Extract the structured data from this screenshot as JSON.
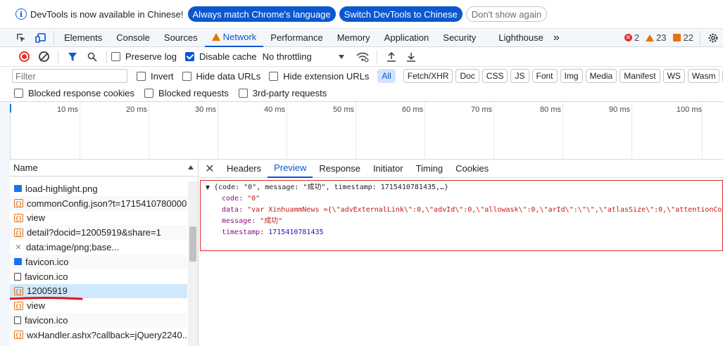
{
  "infobar": {
    "message": "DevTools is now available in Chinese!",
    "btn_match": "Always match Chrome's language",
    "btn_switch": "Switch DevTools to Chinese",
    "btn_dismiss": "Don't show again"
  },
  "tabs": {
    "elements": "Elements",
    "console": "Console",
    "sources": "Sources",
    "network": "Network",
    "performance": "Performance",
    "memory": "Memory",
    "application": "Application",
    "security": "Security",
    "lighthouse": "Lighthouse",
    "more": "»"
  },
  "counters": {
    "errors": "2",
    "warnings": "23",
    "issues": "22"
  },
  "toolbar": {
    "preserve_log": "Preserve log",
    "disable_cache": "Disable cache",
    "throttling": "No throttling"
  },
  "filter": {
    "placeholder": "Filter",
    "invert": "Invert",
    "hide_data_urls": "Hide data URLs",
    "hide_ext_urls": "Hide extension URLs",
    "types": [
      "All",
      "Fetch/XHR",
      "Doc",
      "CSS",
      "JS",
      "Font",
      "Img",
      "Media",
      "Manifest",
      "WS",
      "Wasm",
      "O"
    ]
  },
  "blocked": {
    "cookies": "Blocked response cookies",
    "requests": "Blocked requests",
    "third_party": "3rd-party requests"
  },
  "timeline": {
    "ticks": [
      "10 ms",
      "20 ms",
      "30 ms",
      "40 ms",
      "50 ms",
      "60 ms",
      "70 ms",
      "80 ms",
      "90 ms",
      "100 ms"
    ]
  },
  "requests": {
    "header": "Name",
    "rows": [
      {
        "icon": "png",
        "name": "load-highlight.png"
      },
      {
        "icon": "json",
        "name": "commonConfig.json?t=1715410780000"
      },
      {
        "icon": "json",
        "name": "view"
      },
      {
        "icon": "json",
        "name": "detail?docid=12005919&share=1"
      },
      {
        "icon": "img",
        "name": "data:image/png;base..."
      },
      {
        "icon": "png",
        "name": "favicon.ico"
      },
      {
        "icon": "doc",
        "name": "favicon.ico"
      },
      {
        "icon": "json",
        "name": "12005919"
      },
      {
        "icon": "json",
        "name": "view"
      },
      {
        "icon": "doc",
        "name": "favicon.ico"
      },
      {
        "icon": "json",
        "name": "wxHandler.ashx?callback=jQuery2240..."
      }
    ]
  },
  "detail": {
    "tabs": [
      "Headers",
      "Preview",
      "Response",
      "Initiator",
      "Timing",
      "Cookies"
    ],
    "active_tab": "Preview",
    "summary": "{code: \"0\", message: \"成功\", timestamp: 1715410781435,…}",
    "fields": {
      "code_key": "code:",
      "code_val": "\"0\"",
      "data_key": "data:",
      "data_val": "\"var XinhuammNews ={\\\"advExternalLink\\\":0,\\\"advId\\\":0,\\\"allowask\\\":0,\\\"arId\\\":\\\"\\\",\\\"atlasSize\\\":0,\\\"attentionCou",
      "message_key": "message:",
      "message_val": "\"成功\"",
      "timestamp_key": "timestamp:",
      "timestamp_val": "1715410781435"
    }
  },
  "colors": {
    "accent": "#0b57d0",
    "error": "#dc362e",
    "warning": "#e37400",
    "highlight_box": "#d93025",
    "selected_row": "#cfe8fc"
  }
}
